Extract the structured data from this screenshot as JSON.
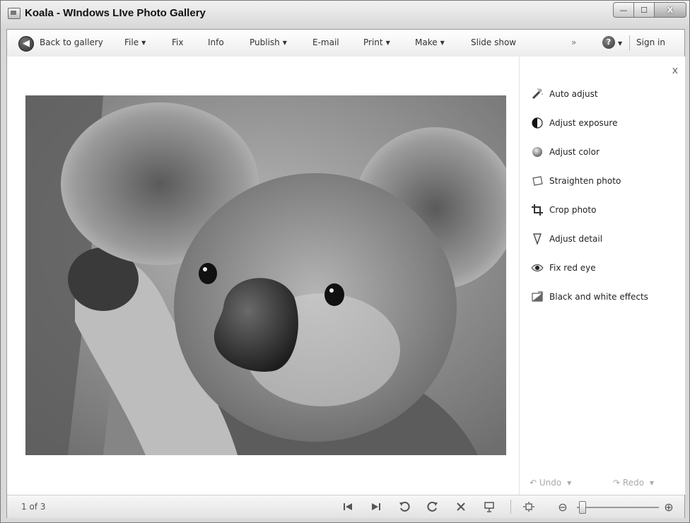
{
  "window": {
    "title": "Koala - WIndows LIve Photo Gallery",
    "minimize_glyph": "—",
    "maximize_glyph": "☐",
    "close_glyph": "X"
  },
  "toolbar": {
    "back_label": "Back to gallery",
    "file_label": "File",
    "fix_label": "Fix",
    "info_label": "Info",
    "publish_label": "Publish",
    "email_label": "E-mail",
    "print_label": "Print",
    "make_label": "Make",
    "slideshow_label": "Slide show",
    "more_glyph": "»",
    "help_glyph": "?",
    "signin_label": "Sign in",
    "caret_glyph": "▼"
  },
  "photo": {
    "subject": "koala"
  },
  "fix_panel": {
    "close_glyph": "x",
    "items": [
      {
        "label": "Auto adjust",
        "icon": "magic-wand-icon"
      },
      {
        "label": "Adjust exposure",
        "icon": "half-circle-icon"
      },
      {
        "label": "Adjust color",
        "icon": "color-ball-icon"
      },
      {
        "label": "Straighten photo",
        "icon": "straighten-icon"
      },
      {
        "label": "Crop photo",
        "icon": "crop-icon"
      },
      {
        "label": "Adjust detail",
        "icon": "detail-icon"
      },
      {
        "label": "Fix red eye",
        "icon": "eye-icon"
      },
      {
        "label": "Black and white effects",
        "icon": "bw-effects-icon"
      }
    ],
    "undo_label": "Undo",
    "redo_label": "Redo"
  },
  "statusbar": {
    "counter": "1 of 3",
    "zoom_level": 0.05,
    "zoom_minus_glyph": "⊖",
    "zoom_plus_glyph": "⊕"
  }
}
